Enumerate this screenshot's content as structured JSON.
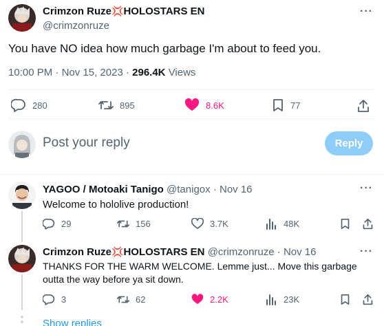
{
  "main_tweet": {
    "author_name": "Crimzon Ruze",
    "author_suffix": "HOLOSTARS EN",
    "handle": "@crimzonruze",
    "text": "You have NO idea how much garbage I'm about to feed you.",
    "time": "10:00 PM",
    "date": "Nov 15, 2023",
    "views_count": "296.4K",
    "views_label": "Views",
    "more_label": "···",
    "stats": {
      "replies": "280",
      "reposts": "895",
      "likes": "8.6K",
      "bookmarks": "77"
    }
  },
  "composer": {
    "placeholder": "Post your reply",
    "button_label": "Reply"
  },
  "replies": [
    {
      "author_name": "YAGOO / Motoaki Tanigo",
      "handle": "@tanigox",
      "date": "Nov 16",
      "text": "Welcome to hololive production!",
      "stats": {
        "replies": "29",
        "reposts": "156",
        "likes": "3.7K",
        "views": "48K"
      }
    },
    {
      "author_name": "Crimzon Ruze",
      "author_suffix": "HOLOSTARS EN",
      "handle": "@crimzonruze",
      "date": "Nov 16",
      "text_line1": "THANKS FOR THE WARM WELCOME.  Lemme just...  Move this garbage",
      "text_line2": "outta the way before ya sit down.",
      "stats": {
        "replies": "3",
        "reposts": "62",
        "likes": "2.2K",
        "views": "23K"
      }
    }
  ],
  "show_replies_label": "Show replies",
  "colors": {
    "accent": "#1d9bf0",
    "like_active": "#f91880",
    "muted": "#536471",
    "text": "#0f1419",
    "reply_button": "#8ecdf8"
  }
}
